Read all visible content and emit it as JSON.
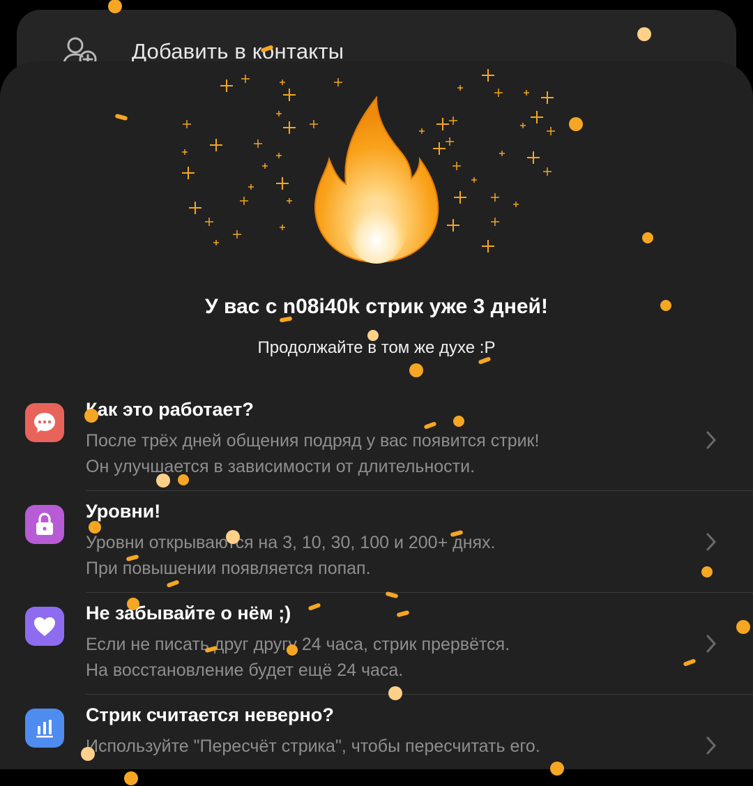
{
  "contact_bar": {
    "label": "Добавить в контакты",
    "icon": "add-user-icon"
  },
  "streak": {
    "title": "У вас с n08i40k стрик уже 3 дней!",
    "subtitle": "Продолжайте в том же духе :P",
    "icon": "fire-icon"
  },
  "items": [
    {
      "title": "Как это работает?",
      "line1": "После трёх дней общения подряд у вас появится стрик!",
      "line2": "Он улучшается в зависимости от длительности.",
      "icon": "chat-bubble-icon",
      "color": "#E8645A"
    },
    {
      "title": "Уровни!",
      "line1": "Уровни открываются на 3, 10, 30, 100 и 200+ днях.",
      "line2": "При повышении появляется попап.",
      "icon": "lock-icon",
      "color": "#B85CD6"
    },
    {
      "title": "Не забывайте о нём ;)",
      "line1": "Если не писать друг другу 24 часа, стрик прервётся.",
      "line2": "На восстановление будет ещё 24 часа.",
      "icon": "heart-icon",
      "color": "#8E6CF0"
    },
    {
      "title": "Стрик считается неверно?",
      "line1": "Используйте \"Пересчёт стрика\", чтобы пересчитать его.",
      "line2": "",
      "icon": "bar-chart-icon",
      "color": "#4E8CF0"
    }
  ],
  "colors": {
    "confetti": "#F5A623",
    "confetti_light": "#FFD08A",
    "background": "#212121"
  }
}
